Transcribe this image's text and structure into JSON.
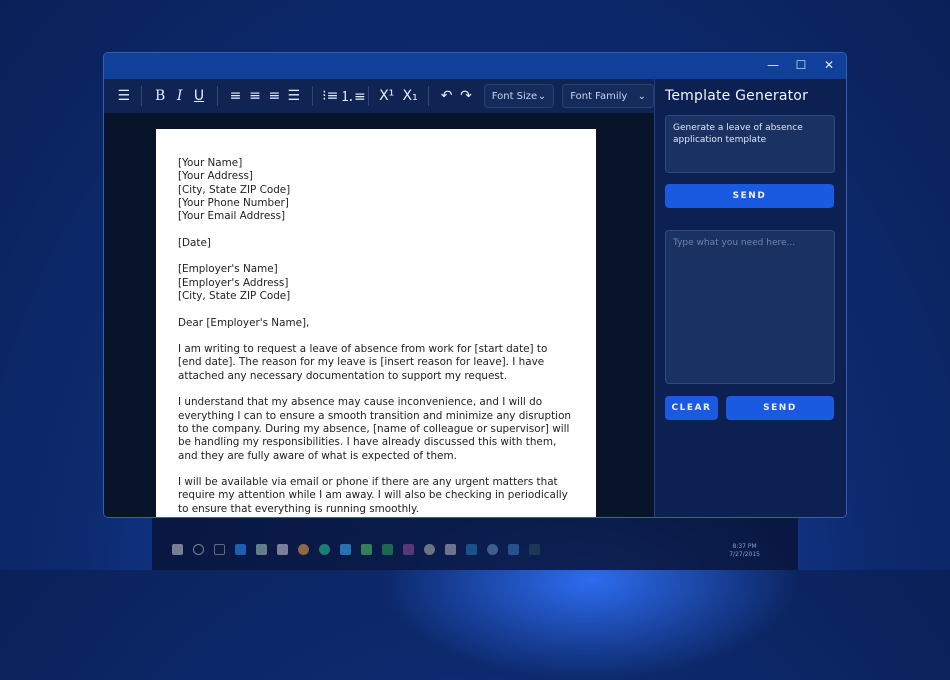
{
  "toolbar": {
    "icons": [
      "menu-icon",
      "bold-icon",
      "italic-icon",
      "underline-icon",
      "align-left-icon",
      "align-center-icon",
      "align-right-icon",
      "align-justify-icon",
      "bulleted-list-icon",
      "numbered-list-icon",
      "superscript-icon",
      "subscript-icon",
      "undo-icon",
      "redo-icon"
    ],
    "bold": "B",
    "italic": "I",
    "underline": "U",
    "superscript": "X¹",
    "subscript": "X₁",
    "undo": "↶",
    "redo": "↷",
    "font_size": "Font Size",
    "font_family": "Font Family"
  },
  "window": {
    "minimize": "—",
    "maximize": "☐",
    "close": "✕"
  },
  "document": {
    "lines": [
      [
        "[Your Name]",
        "[Your Address]",
        "[City, State ZIP Code]",
        "[Your Phone Number]",
        "[Your Email Address]"
      ],
      [
        "[Date]"
      ],
      [
        "[Employer's Name]",
        "[Employer's Address]",
        "[City, State ZIP Code]"
      ],
      [
        "Dear [Employer's Name],"
      ],
      [
        "I am writing to request a leave of absence from work for [start date] to [end date]. The reason for my leave is [insert reason for leave]. I have attached any necessary documentation to support my request."
      ],
      [
        "I understand that my absence may cause inconvenience, and I will do everything I can to ensure a smooth transition and minimize any disruption to the company. During my absence, [name of colleague or supervisor] will be handling my responsibilities. I have already discussed this with them, and they are fully aware of what is expected of them."
      ],
      [
        "I will be available via email or phone if there are any urgent matters that require my attention while I am away. I will also be checking in periodically to ensure that everything is running smoothly."
      ]
    ]
  },
  "sidebar": {
    "title": "Template Generator",
    "prompt_value": "Generate a leave of absence application template",
    "send_label": "SEND",
    "input_placeholder": "Type what you need here...",
    "clear_label": "CLEAR",
    "send2_label": "SEND"
  },
  "taskbar": {
    "time": "8:37 PM",
    "date": "7/27/2015"
  },
  "colors": {
    "accent": "#1a5ae0",
    "titlebar": "#10409a",
    "panel": "#0c2152"
  }
}
